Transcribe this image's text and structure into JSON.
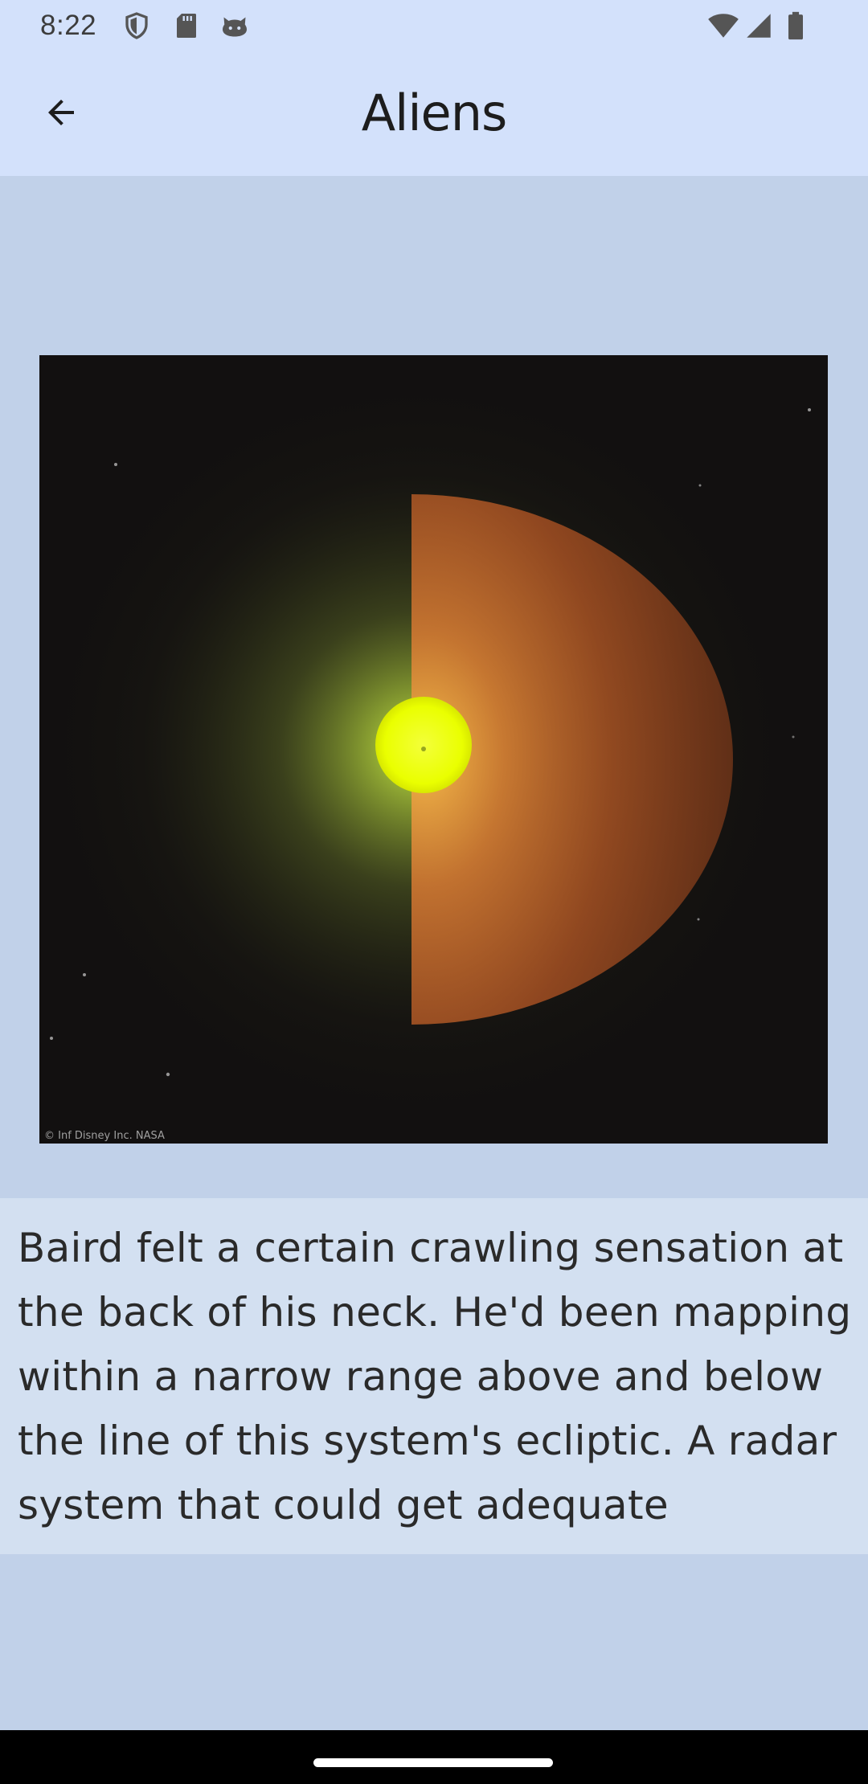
{
  "status_bar": {
    "time": "8:22",
    "left_icons": [
      "shield-icon",
      "sd-card-icon",
      "cat-face-icon"
    ],
    "right_icons": [
      "wifi-icon",
      "cell-signal-icon",
      "battery-icon"
    ]
  },
  "app_bar": {
    "title": "Aliens",
    "back_icon": "arrow-back-icon"
  },
  "illustration": {
    "description_icon": "star-system-image",
    "caption": "© Inf Disney Inc. NASA",
    "colors": {
      "star": "#eaff00",
      "hemisphere": "#b4541e",
      "glow": "#a6c43a",
      "space": "#121010"
    }
  },
  "content": {
    "excerpt": "Baird felt a certain crawling sensation at the back of his neck. He'd been mapping within a narrow range above and below the line of this system's ecliptic. A radar system that could get adequate"
  }
}
